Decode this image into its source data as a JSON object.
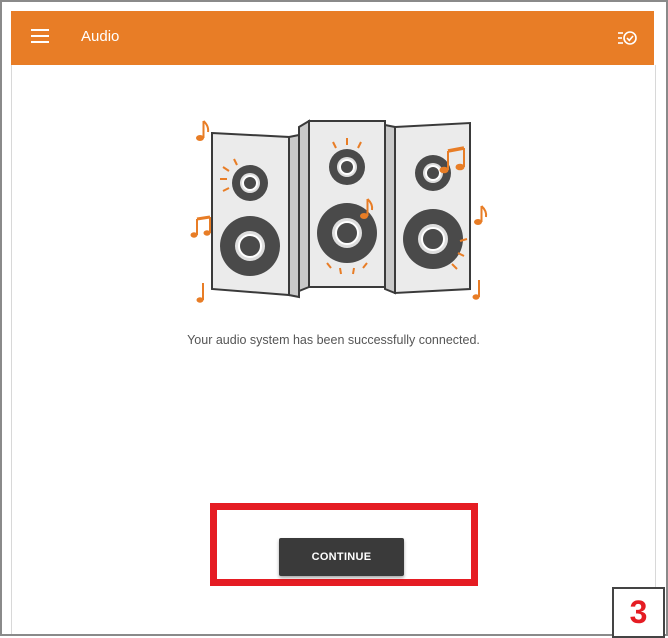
{
  "appbar": {
    "title": "Audio",
    "menu_icon": "hamburger-menu-icon",
    "action_icon": "task-check-icon",
    "color": "#e87d26"
  },
  "main": {
    "illustration": "speakers-with-music-notes",
    "message": "Your audio system has been successfully connected.",
    "continue_label": "CONTINUE"
  },
  "annotation": {
    "step_number": "3",
    "highlight_color": "#e51c23"
  }
}
